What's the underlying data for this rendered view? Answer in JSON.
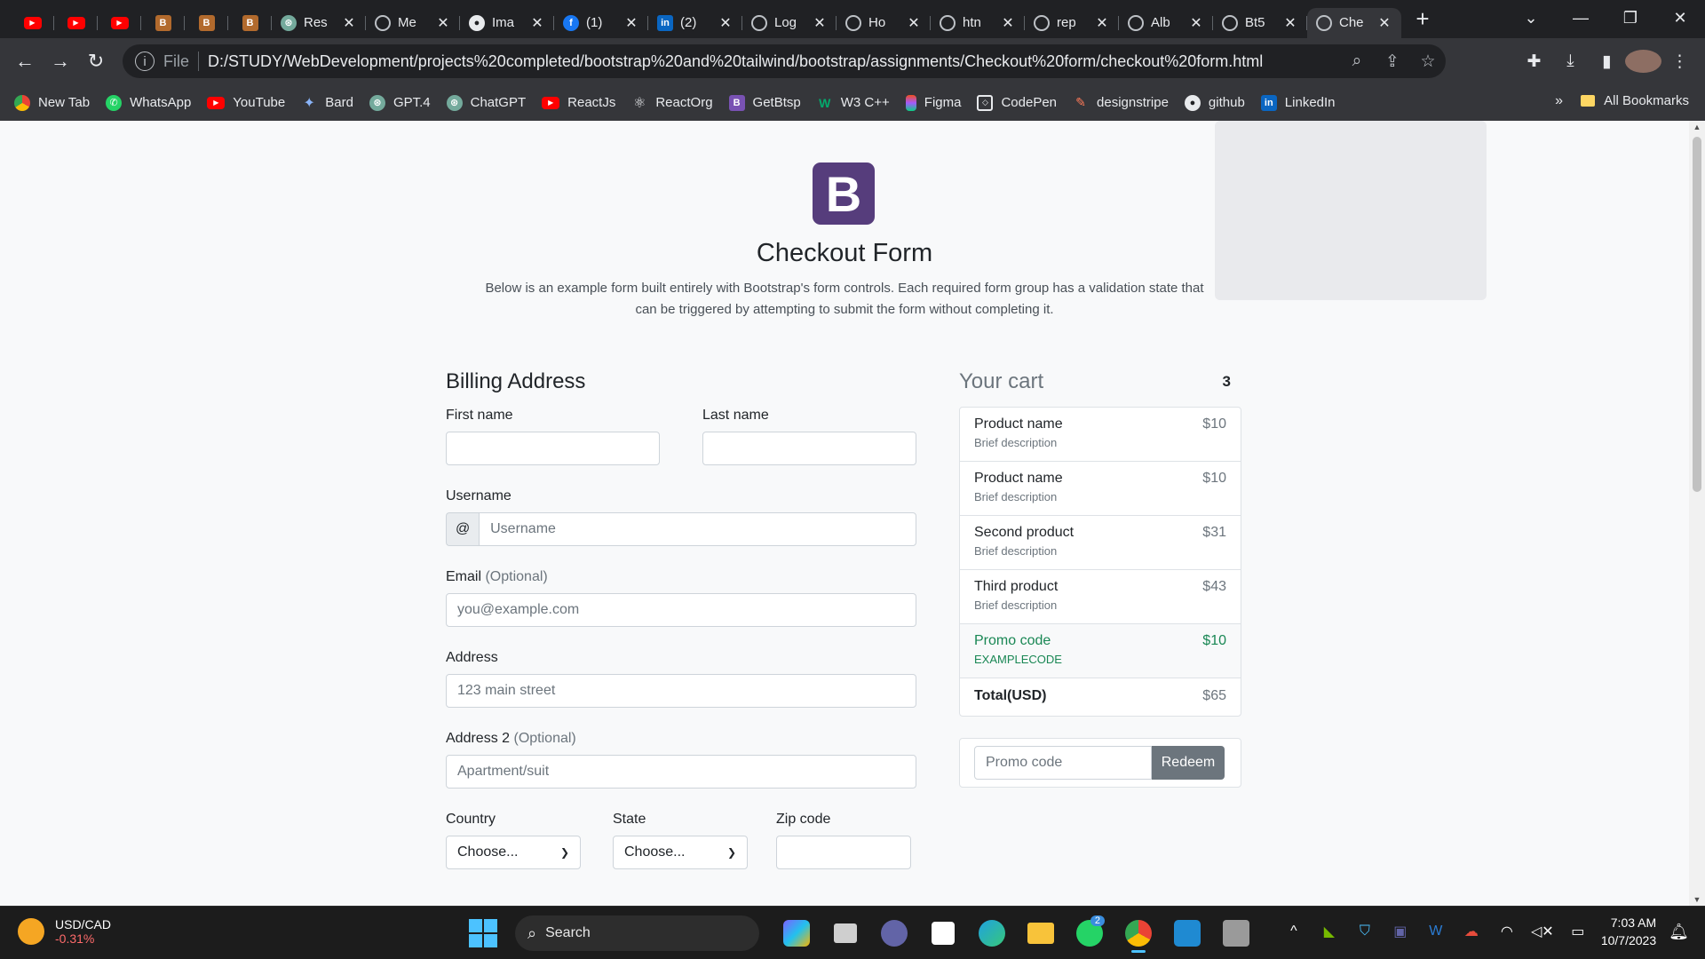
{
  "browser": {
    "pinned_tabs": [
      {
        "icon": "youtube-icon"
      },
      {
        "icon": "youtube-icon"
      },
      {
        "icon": "youtube-icon"
      },
      {
        "icon": "bootstrap-doc-icon"
      },
      {
        "icon": "bootstrap-doc-icon"
      },
      {
        "icon": "bootstrap-doc-icon"
      }
    ],
    "tabs": [
      {
        "title": "Res",
        "icon": "chatgpt-icon"
      },
      {
        "title": "Me",
        "icon": "globe-icon"
      },
      {
        "title": "Ima",
        "icon": "github-icon"
      },
      {
        "title": "(1)",
        "icon": "facebook-icon"
      },
      {
        "title": "(2)",
        "icon": "linkedin-icon"
      },
      {
        "title": "Log",
        "icon": "globe-icon"
      },
      {
        "title": "Ho",
        "icon": "globe-icon"
      },
      {
        "title": "htn",
        "icon": "globe-icon"
      },
      {
        "title": "rep",
        "icon": "globe-icon"
      },
      {
        "title": "Alb",
        "icon": "globe-icon"
      },
      {
        "title": "Bt5",
        "icon": "globe-icon"
      },
      {
        "title": "Che",
        "icon": "globe-icon",
        "active": true
      }
    ],
    "new_tab": "+",
    "address": {
      "scheme_label": "File",
      "url": "D:/STUDY/WebDevelopment/projects%20completed/bootstrap%20and%20tailwind/bootstrap/assignments/Checkout%20form/checkout%20form.html"
    },
    "bookmarks": [
      {
        "label": "New Tab",
        "icon": "chrome-icon"
      },
      {
        "label": "WhatsApp",
        "icon": "whatsapp-icon"
      },
      {
        "label": "YouTube",
        "icon": "youtube-icon"
      },
      {
        "label": "Bard",
        "icon": "bard-icon"
      },
      {
        "label": "GPT.4",
        "icon": "chatgpt-icon"
      },
      {
        "label": "ChatGPT",
        "icon": "chatgpt-icon"
      },
      {
        "label": "ReactJs",
        "icon": "youtube-icon"
      },
      {
        "label": "ReactOrg",
        "icon": "react-icon"
      },
      {
        "label": "GetBtsp",
        "icon": "bootstrap-icon"
      },
      {
        "label": "W3 C++",
        "icon": "w3-icon"
      },
      {
        "label": "Figma",
        "icon": "figma-icon"
      },
      {
        "label": "CodePen",
        "icon": "codepen-icon"
      },
      {
        "label": "designstripe",
        "icon": "designstripe-icon"
      },
      {
        "label": "github",
        "icon": "github-icon"
      },
      {
        "label": "LinkedIn",
        "icon": "linkedin-icon"
      }
    ],
    "more_bookmarks": "»",
    "all_bookmarks": "All Bookmarks"
  },
  "page": {
    "logo_letter": "B",
    "title": "Checkout Form",
    "lead": "Below is an example form built entirely with Bootstrap's form controls. Each required form group has a validation state that can be triggered by attempting to submit the form without completing it.",
    "billing": {
      "heading": "Billing Address",
      "first_name": {
        "label": "First name",
        "value": "",
        "placeholder": ""
      },
      "last_name": {
        "label": "Last name",
        "value": "",
        "placeholder": ""
      },
      "username": {
        "label": "Username",
        "prefix": "@",
        "placeholder": "Username"
      },
      "email": {
        "label": "Email",
        "optional": "(Optional)",
        "placeholder": "you@example.com"
      },
      "address": {
        "label": "Address",
        "placeholder": "123 main street"
      },
      "address2": {
        "label": "Address 2",
        "optional": "(Optional)",
        "placeholder": "Apartment/suit"
      },
      "country": {
        "label": "Country",
        "selected": "Choose..."
      },
      "state": {
        "label": "State",
        "selected": "Choose..."
      },
      "zip": {
        "label": "Zip code",
        "placeholder": ""
      }
    },
    "cart": {
      "heading": "Your cart",
      "count": "3",
      "items": [
        {
          "name": "Product name",
          "desc": "Brief description",
          "price": "$10"
        },
        {
          "name": "Product name",
          "desc": "Brief description",
          "price": "$10"
        },
        {
          "name": "Second product",
          "desc": "Brief description",
          "price": "$31"
        },
        {
          "name": "Third product",
          "desc": "Brief description",
          "price": "$43"
        }
      ],
      "promo": {
        "name": "Promo code",
        "code": "EXAMPLECODE",
        "price": "$10"
      },
      "total": {
        "label": "Total(USD)",
        "price": "$65"
      },
      "promo_input_placeholder": "Promo code",
      "redeem_label": "Redeem"
    }
  },
  "taskbar": {
    "ticker": {
      "pair": "USD/CAD",
      "change": "-0.31%"
    },
    "search_label": "Search",
    "apps": [
      {
        "icon": "copilot-icon",
        "color": "#7b61ff"
      },
      {
        "icon": "task-view-icon",
        "color": "#cfcfcf"
      },
      {
        "icon": "teams-meet-icon",
        "color": "#6264a7"
      },
      {
        "icon": "store-icon",
        "color": "#ffffff"
      },
      {
        "icon": "edge-icon",
        "color": "#1fa2e0"
      },
      {
        "icon": "file-explorer-icon",
        "color": "#f8c33a"
      },
      {
        "icon": "whatsapp-icon",
        "color": "#25d366",
        "badge": "2"
      },
      {
        "icon": "chrome-icon",
        "color": "#e84335",
        "active": true
      },
      {
        "icon": "vscode-icon",
        "color": "#1f8ad2"
      },
      {
        "icon": "clipchamp-icon",
        "color": "#9a9a9a"
      }
    ],
    "time": "7:03 AM",
    "date": "10/7/2023"
  },
  "colors": {
    "bootstrap_purple": "#563d7c",
    "success_green": "#198754",
    "secondary_gray": "#6c757d"
  }
}
